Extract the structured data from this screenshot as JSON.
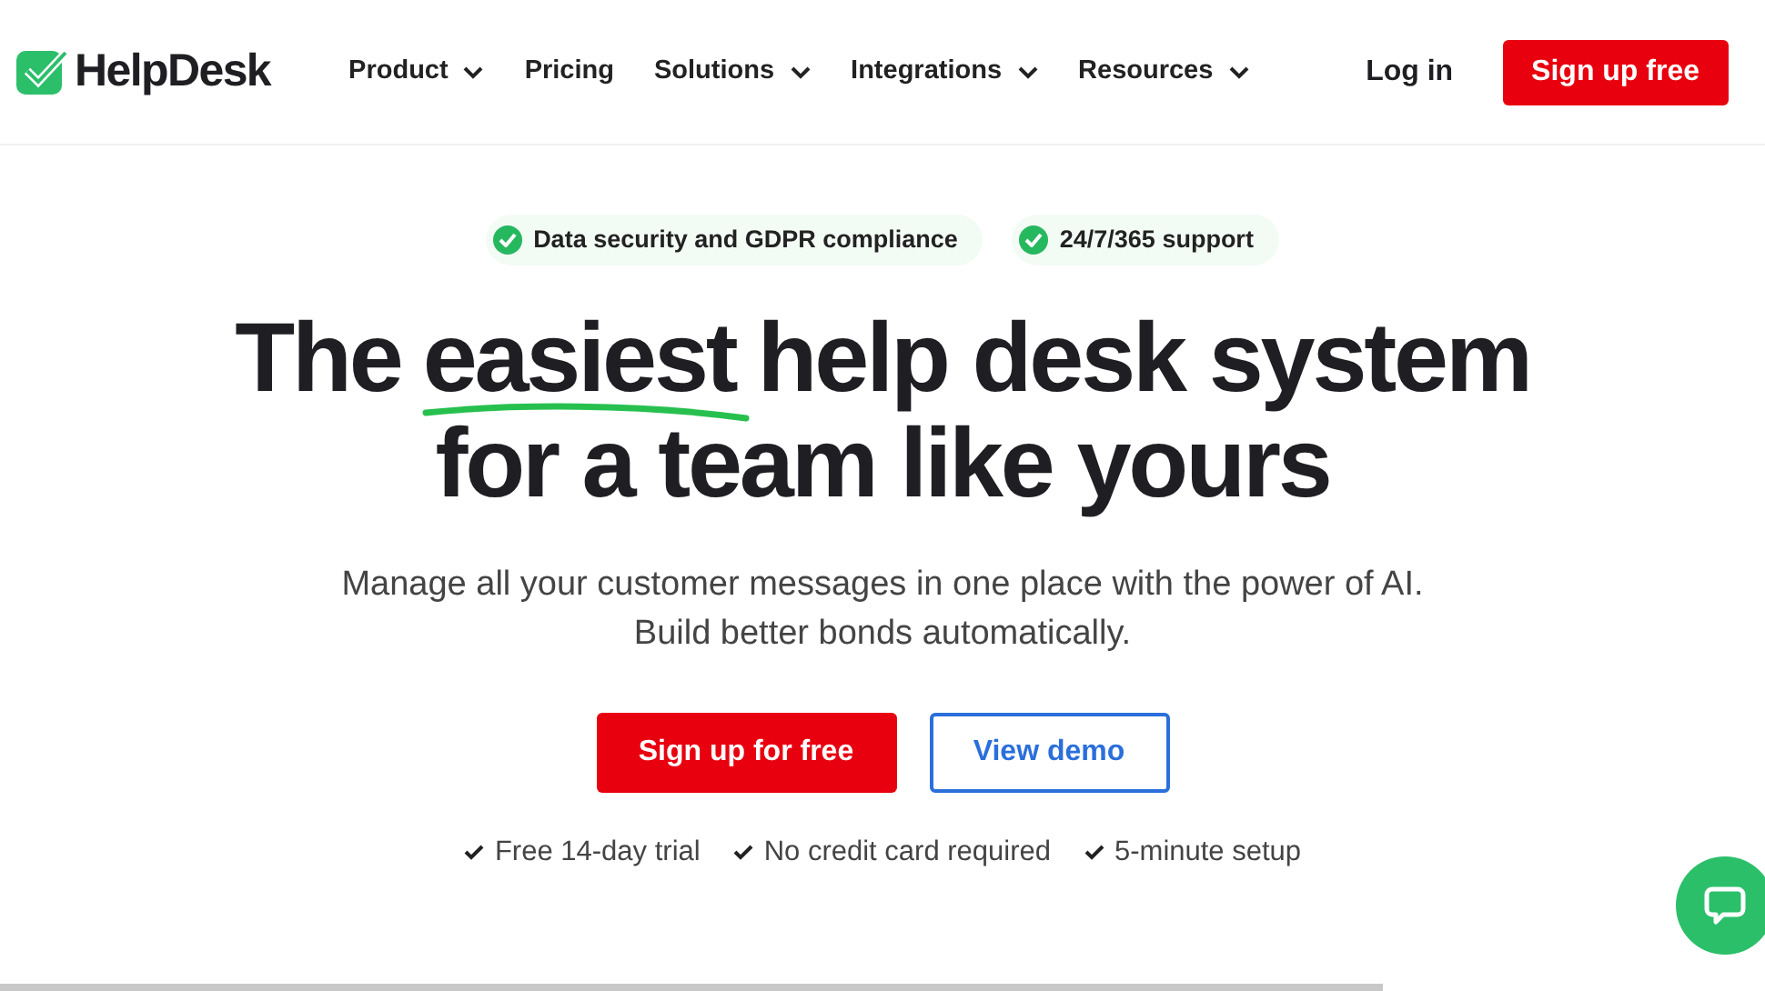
{
  "logo": {
    "text": "HelpDesk"
  },
  "nav": [
    {
      "label": "Product",
      "has_dropdown": true
    },
    {
      "label": "Pricing",
      "has_dropdown": false
    },
    {
      "label": "Solutions",
      "has_dropdown": true
    },
    {
      "label": "Integrations",
      "has_dropdown": true
    },
    {
      "label": "Resources",
      "has_dropdown": true
    }
  ],
  "login": "Log in",
  "signup": "Sign up free",
  "badges": [
    "Data security and GDPR compliance",
    "24/7/365 support"
  ],
  "headline": {
    "before": "The",
    "highlight": "easiest",
    "after": "help desk system",
    "line2": "for a team like yours"
  },
  "subtitle": [
    "Manage all your customer messages in one place with the power of AI.",
    "Build better bonds automatically."
  ],
  "cta": {
    "primary": "Sign up for free",
    "secondary": "View demo"
  },
  "perks": [
    "Free 14-day trial",
    "No credit card required",
    "5-minute setup"
  ]
}
